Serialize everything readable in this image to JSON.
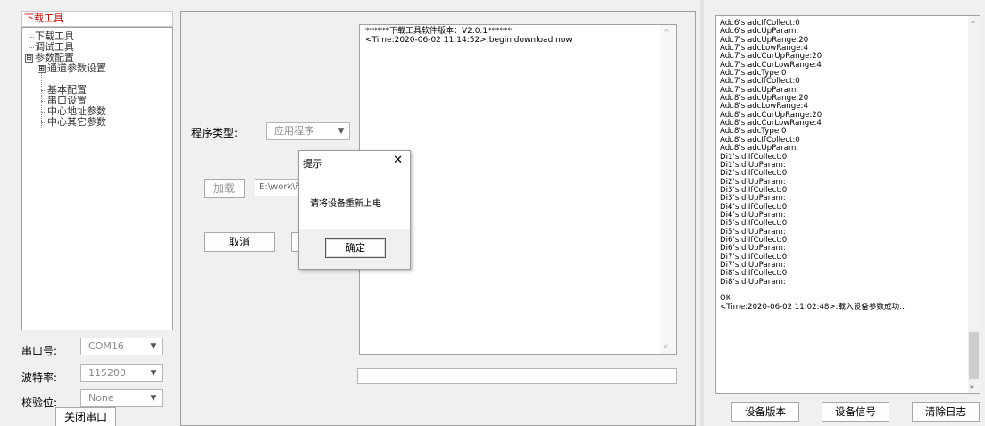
{
  "left": {
    "title": "下载工具",
    "tree": [
      {
        "label": "下载工具"
      },
      {
        "label": "调试工具"
      },
      {
        "label": "参数配置",
        "expander": "⊟"
      },
      {
        "label": "通道参数设置",
        "expander": "⊞"
      },
      {
        "label": "基本配置"
      },
      {
        "label": "串口设置"
      },
      {
        "label": "中心地址参数"
      },
      {
        "label": "中心其它参数"
      }
    ],
    "port_label": "串口号:",
    "port_value": "COM16",
    "baud_label": "波特率:",
    "baud_value": "115200",
    "parity_label": "校验位:",
    "parity_value": "None",
    "close_port_button": "关闭串口"
  },
  "middle": {
    "program_type_label": "程序类型:",
    "program_type_value": "应用程序",
    "load_button": "加载",
    "path_value": "E:\\work\\产",
    "cancel_button": "取消",
    "log_lines": [
      "******下载工具软件版本：V2.0.1******",
      "<Time:2020-06-02 11:14:52>:begin download  now"
    ]
  },
  "dialog": {
    "title": "提示",
    "close_glyph": "✕",
    "message": "请将设备重新上电",
    "ok_button": "确定"
  },
  "right": {
    "log_lines": [
      "Adc6's adcIfCollect:0",
      "Adc6's adcUpParam:",
      "Adc7's adcUpRange:20",
      "Adc7's adcLowRange:4",
      "Adc7's adcCurUpRange:20",
      "Adc7's adcCurLowRange:4",
      "Adc7's adcType:0",
      "Adc7's adcIfCollect:0",
      "Adc7's adcUpParam:",
      "Adc8's adcUpRange:20",
      "Adc8's adcLowRange:4",
      "Adc8's adcCurUpRange:20",
      "Adc8's adcCurLowRange:4",
      "Adc8's adcType:0",
      "Adc8's adcIfCollect:0",
      "Adc8's adcUpParam:",
      "Di1's diIfCollect:0",
      "Di1's diUpParam:",
      "Di2's diIfCollect:0",
      "Di2's diUpParam:",
      "Di3's diIfCollect:0",
      "Di3's diUpParam:",
      "Di4's diIfCollect:0",
      "Di4's diUpParam:",
      "Di5's diIfCollect:0",
      "Di5's diUpParam:",
      "Di6's diIfCollect:0",
      "Di6's diUpParam:",
      "Di7's diIfCollect:0",
      "Di7's diUpParam:",
      "Di8's diIfCollect:0",
      "Di8's diUpParam:",
      "",
      "OK",
      "<Time:2020-06-02 11:02:48>:载入设备参数成功…"
    ],
    "device_version_button": "设备版本",
    "device_signal_button": "设备信号",
    "clear_log_button": "清除日志"
  }
}
